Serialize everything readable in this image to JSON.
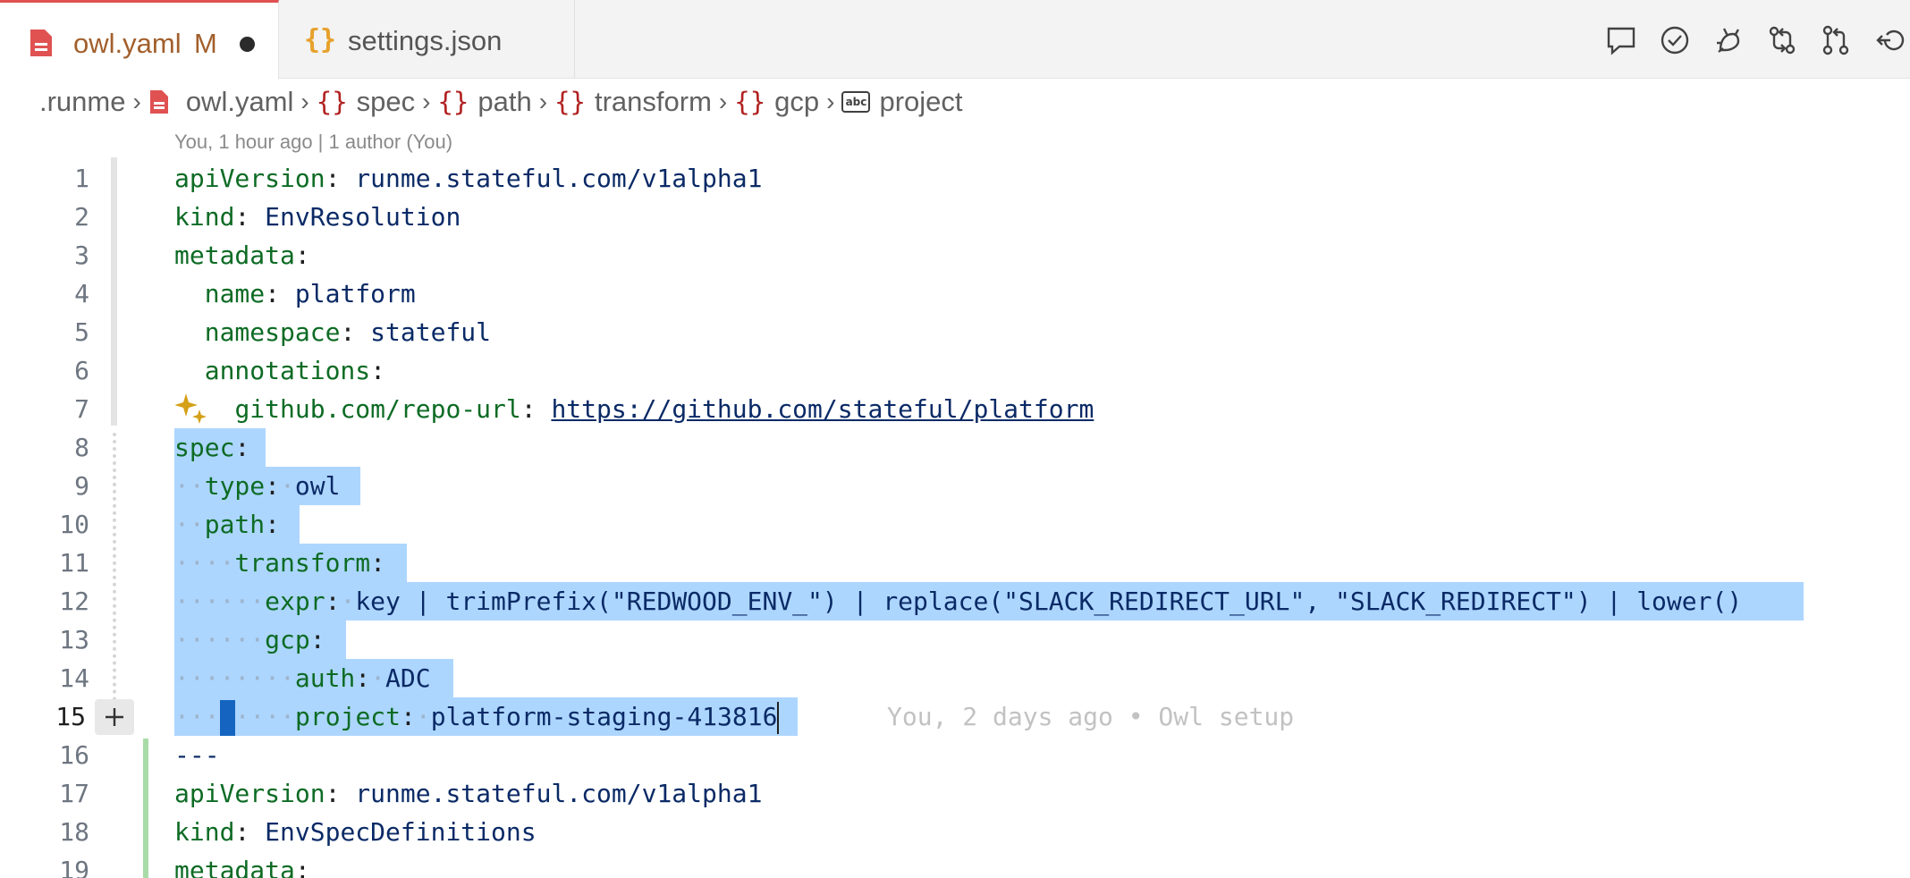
{
  "tabs": [
    {
      "label": "owl.yaml",
      "modified": "M",
      "active": true
    },
    {
      "label": "settings.json",
      "icon_text": "{}",
      "active": false
    }
  ],
  "toolbar": [
    "comment-icon",
    "check-circle-icon",
    "debug-bug-icon",
    "compare-changes-icon",
    "pull-request-icon",
    "revert-icon"
  ],
  "breadcrumb": {
    "root": ".runme",
    "file": "owl.yaml",
    "obj_icon": "{}",
    "abc_icon": "abc",
    "items": [
      "spec",
      "path",
      "transform",
      "gcp"
    ],
    "last": "project"
  },
  "blame_header": "You, 1 hour ago | 1 author (You)",
  "inline_blame": "You, 2 days ago • Owl setup",
  "lines": {
    "n": [
      "1",
      "2",
      "3",
      "4",
      "5",
      "6",
      "7",
      "8",
      "9",
      "10",
      "11",
      "12",
      "13",
      "14",
      "15",
      "16",
      "17",
      "18",
      "19"
    ],
    "l1": {
      "k": "apiVersion",
      "v": "runme.stateful.com/v1alpha1"
    },
    "l2": {
      "k": "kind",
      "v": "EnvResolution"
    },
    "l3": {
      "k": "metadata"
    },
    "l4": {
      "k": "name",
      "v": "platform"
    },
    "l5": {
      "k": "namespace",
      "v": "stateful"
    },
    "l6": {
      "k": "annotations"
    },
    "l7": {
      "k": "github.com/repo-url",
      "v": "https://github.com/stateful/platform"
    },
    "l8": {
      "k": "spec"
    },
    "l9": {
      "k": "type",
      "v": "owl"
    },
    "l10": {
      "k": "path"
    },
    "l11": {
      "k": "transform"
    },
    "l12": {
      "k": "expr",
      "v": "key | trimPrefix(\"REDWOOD_ENV_\") | replace(\"SLACK_REDIRECT_URL\", \"SLACK_REDIRECT\") | lower()"
    },
    "l13": {
      "k": "gcp"
    },
    "l14": {
      "k": "auth",
      "v": "ADC"
    },
    "l15": {
      "k": "project",
      "v": "platform-staging-413816"
    },
    "l16": {
      "v": "---"
    },
    "l17": {
      "k": "apiVersion",
      "v": "runme.stateful.com/v1alpha1"
    },
    "l18": {
      "k": "kind",
      "v": "EnvSpecDefinitions"
    },
    "l19": {
      "k": "metadata"
    }
  },
  "colors": {
    "key": "#0d6b24",
    "value": "#0a2a66",
    "selection": "#add6ff",
    "tab_accent": "#e05252"
  }
}
